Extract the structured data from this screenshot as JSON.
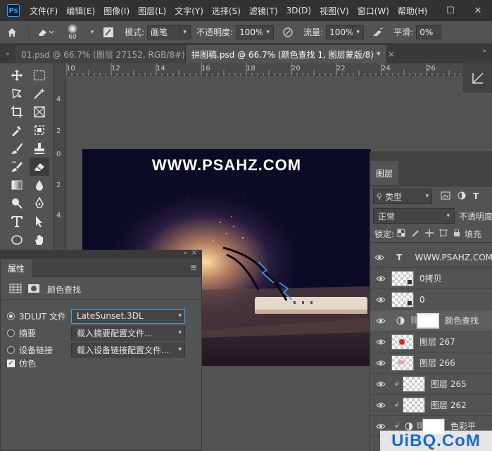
{
  "menu": {
    "logo": "Ps",
    "items": [
      "文件(F)",
      "编辑(E)",
      "图像(I)",
      "图层(L)",
      "文字(Y)",
      "选择(S)",
      "滤镜(T)",
      "3D(D)",
      "视图(V)",
      "窗口(W)",
      "帮助(H)"
    ],
    "window_controls": [
      "—",
      "☐",
      "✕"
    ]
  },
  "options": {
    "brush_size": "60",
    "mode_label": "模式:",
    "mode_value": "画笔",
    "opacity_label": "不透明度:",
    "opacity_value": "100%",
    "flow_label": "流量:",
    "flow_value": "100%",
    "smooth_label": "平滑:",
    "smooth_value": "0%"
  },
  "tabs": [
    {
      "label": "01.psd @ 66.7% (图层 27152, RGB/8#) *",
      "close": "×",
      "active": false
    },
    {
      "label": "拼图稿.psd @ 66.7% (颜色查找 1, 图层蒙版/8) *",
      "close": "×",
      "active": true
    }
  ],
  "rulers": {
    "top": [
      "10",
      "12",
      "14",
      "16",
      "18",
      "20",
      "22",
      "24",
      "26"
    ],
    "left": [
      "4",
      "2",
      "0",
      "2",
      "4"
    ]
  },
  "canvas": {
    "watermark": "WWW.PSAHZ.COM"
  },
  "layers": {
    "tab_label": "图层",
    "filter_label": "类型",
    "blend_mode": "正常",
    "opacity_label": "不透明度",
    "lock_label": "锁定:",
    "fill_label": "填充",
    "items": [
      {
        "name": "WWW.PSAHZ.COM",
        "kind": "text"
      },
      {
        "name": "0拷贝",
        "kind": "smart"
      },
      {
        "name": "0",
        "kind": "smart"
      },
      {
        "name": "颜色查找",
        "kind": "adjustment"
      },
      {
        "name": "图层 267",
        "kind": "pixel"
      },
      {
        "name": "图层 266",
        "kind": "pixel"
      },
      {
        "name": "图层 265",
        "kind": "clipped"
      },
      {
        "name": "图层 262",
        "kind": "clipped"
      },
      {
        "name": "色彩平",
        "kind": "adjustment-clipped"
      }
    ]
  },
  "properties": {
    "tab_label": "属性",
    "adjustment_title": "颜色查找",
    "options": [
      {
        "label": "3DLUT 文件",
        "value": "LateSunset.3DL",
        "selected": true
      },
      {
        "label": "摘要",
        "value": "载入摘要配置文件...",
        "selected": false
      },
      {
        "label": "设备链接",
        "value": "载入设备链接配置文件...",
        "selected": false
      }
    ],
    "dither_label": "仿色",
    "dither_checked": true
  },
  "bottom_watermark": "UiBQ.CoM",
  "colors": {
    "accent": "#31a8ff",
    "panel_bg": "#535353",
    "menubar_bg": "#323232",
    "canvas_bg": "#0a0a22"
  }
}
